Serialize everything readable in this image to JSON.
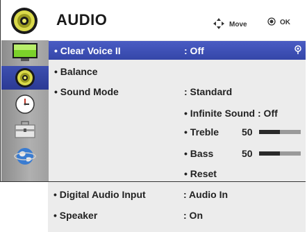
{
  "header": {
    "title": "AUDIO",
    "move_hint": "Move",
    "ok_hint": "OK"
  },
  "sidebar": {
    "items": [
      {
        "icon": "picture-icon",
        "active": false
      },
      {
        "icon": "audio-icon",
        "active": true
      },
      {
        "icon": "clock-icon",
        "active": false
      },
      {
        "icon": "toolbox-icon",
        "active": false
      },
      {
        "icon": "globe-icon",
        "active": false
      }
    ]
  },
  "menu": {
    "clear_voice": {
      "label": "• Clear Voice II",
      "value": ": Off"
    },
    "balance": {
      "label": "• Balance"
    },
    "sound_mode": {
      "label": "• Sound Mode",
      "value": ": Standard"
    },
    "infinite_sound": {
      "label": "• Infinite Sound : Off"
    },
    "treble": {
      "label": "• Treble",
      "value": "50",
      "level_fraction": 0.5
    },
    "bass": {
      "label": "• Bass",
      "value": "50",
      "level_fraction": 0.5
    },
    "reset": {
      "label": "• Reset"
    },
    "digital_audio_input": {
      "label": "• Digital Audio Input",
      "value": ": Audio In"
    },
    "speaker": {
      "label": "• Speaker",
      "value": ": On"
    }
  },
  "colors": {
    "highlight": "#3d4fb0",
    "sidebar": "#a0a0a0",
    "content_bg": "#ececec"
  }
}
